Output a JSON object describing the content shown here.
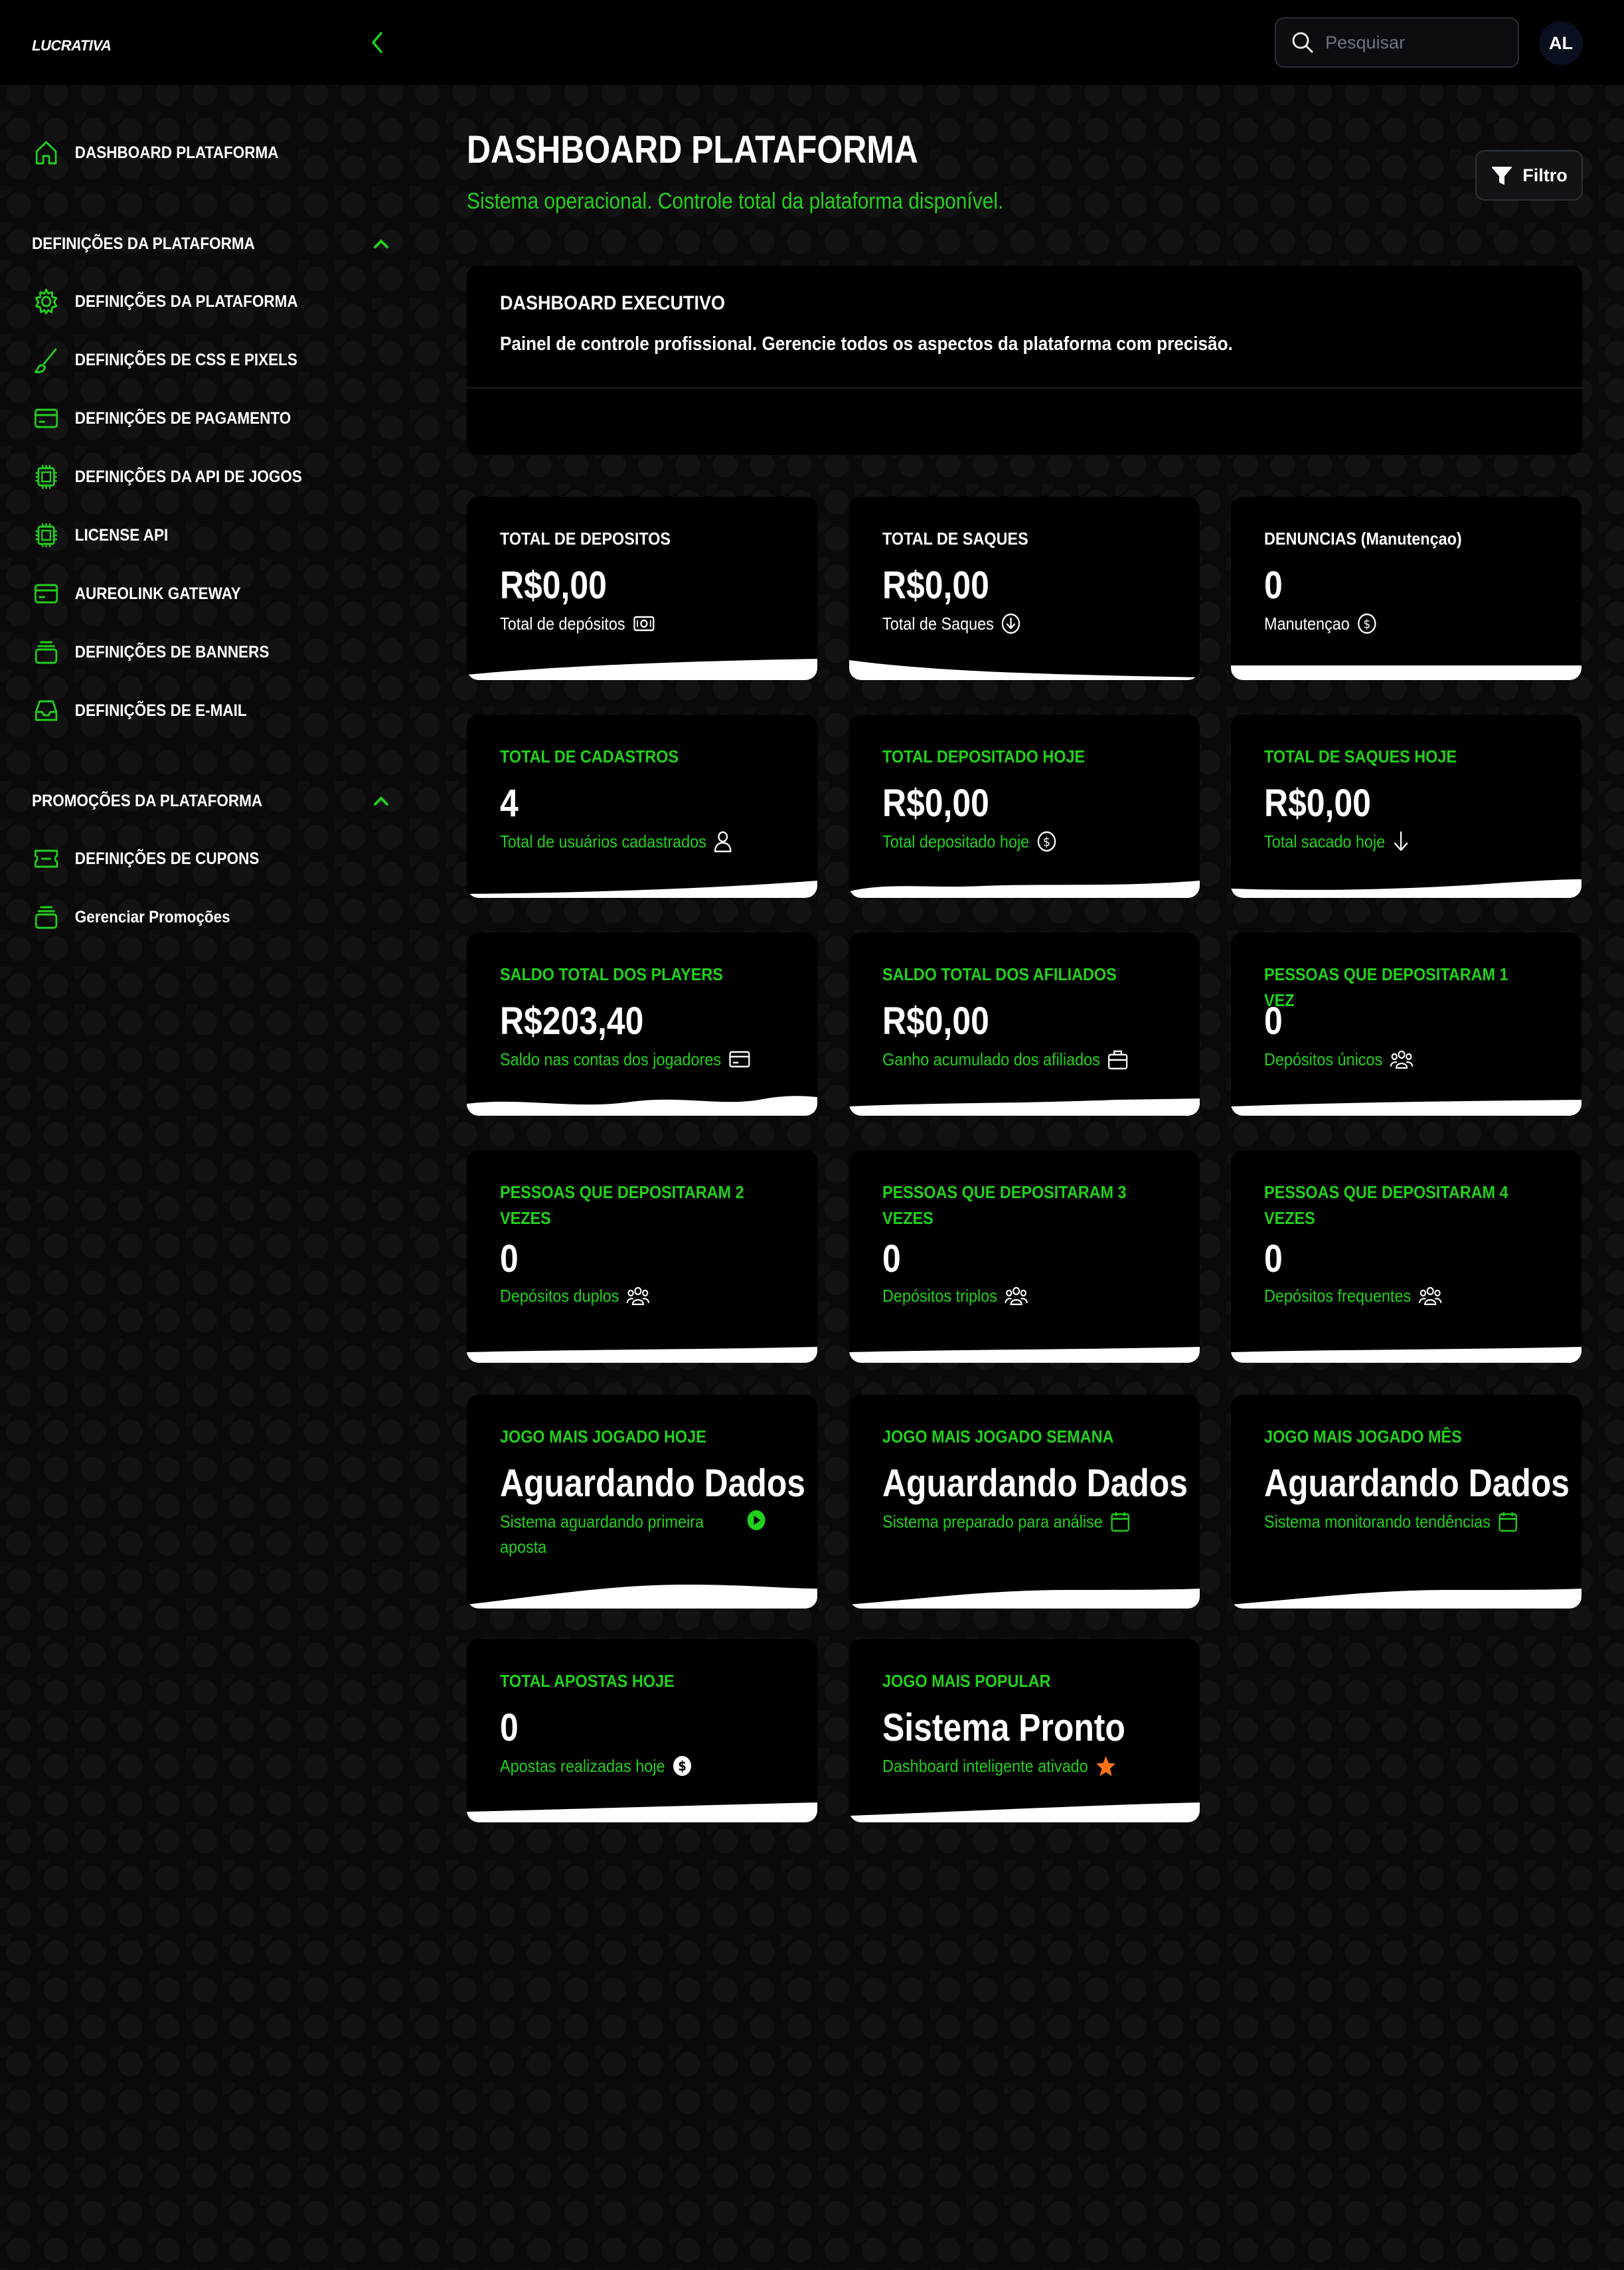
{
  "app": {
    "logo": "LUCRATIVA",
    "avatar": "AL",
    "accent": "#22d11c"
  },
  "search": {
    "placeholder": "Pesquisar",
    "value": ""
  },
  "sidebar": {
    "top_item": {
      "label": "DASHBOARD PLATAFORMA",
      "icon": "home-icon"
    },
    "sections": [
      {
        "title": "DEFINIÇÕES DA PLATAFORMA",
        "expanded": true,
        "items": [
          {
            "label": "DEFINIÇÕES DA PLATAFORMA",
            "icon": "gear-icon"
          },
          {
            "label": "DEFINIÇÕES DE CSS E PIXELS",
            "icon": "brush-icon"
          },
          {
            "label": "DEFINIÇÕES DE PAGAMENTO",
            "icon": "card-icon"
          },
          {
            "label": "DEFINIÇÕES DA API DE JOGOS",
            "icon": "chip-icon"
          },
          {
            "label": "LICENSE API",
            "icon": "chip-icon"
          },
          {
            "label": "AUREOLINK GATEWAY",
            "icon": "card-icon"
          },
          {
            "label": "DEFINIÇÕES DE BANNERS",
            "icon": "stack-icon"
          },
          {
            "label": "DEFINIÇÕES DE E-MAIL",
            "icon": "inbox-icon"
          }
        ]
      },
      {
        "title": "PROMOÇÕES DA PLATAFORMA",
        "expanded": true,
        "items": [
          {
            "label": "DEFINIÇÕES DE CUPONS",
            "icon": "ticket-icon"
          },
          {
            "label": "Gerenciar Promoções",
            "icon": "stack-icon"
          }
        ]
      }
    ]
  },
  "header": {
    "title": "DASHBOARD PLATAFORMA",
    "subtitle": "Sistema operacional. Controle total da plataforma disponível.",
    "filter_label": "Filtro"
  },
  "exec": {
    "title": "DASHBOARD EXECUTIVO",
    "description": "Painel de controle profissional. Gerencie todos os aspectos da plataforma com precisão."
  },
  "cards": [
    {
      "label": "TOTAL DE DEPOSITOS",
      "value": "R$0,00",
      "sub": "Total de depósitos",
      "icon": "cash-icon",
      "style": "white"
    },
    {
      "label": "TOTAL DE SAQUES",
      "value": "R$0,00",
      "sub": "Total de Saques",
      "icon": "arrow-down-circle-icon",
      "style": "white"
    },
    {
      "label": "DENUNCIAS (Manutençao)",
      "value": "0",
      "sub": "Manutençao",
      "icon": "dollar-circle-icon",
      "style": "white"
    },
    {
      "label": "TOTAL DE CADASTROS",
      "value": "4",
      "sub": "Total de usuários cadastrados",
      "icon": "user-icon",
      "style": "green"
    },
    {
      "label": "TOTAL DEPOSITADO HOJE",
      "value": "R$0,00",
      "sub": "Total depositado hoje",
      "icon": "dollar-circle-icon",
      "style": "green"
    },
    {
      "label": "TOTAL DE SAQUES HOJE",
      "value": "R$0,00",
      "sub": "Total sacado hoje",
      "icon": "arrow-down-icon",
      "style": "green"
    },
    {
      "label": "SALDO TOTAL DOS PLAYERS",
      "value": "R$203,40",
      "sub": "Saldo nas contas dos jogadores",
      "icon": "card-icon",
      "style": "green"
    },
    {
      "label": "SALDO TOTAL DOS AFILIADOS",
      "value": "R$0,00",
      "sub": "Ganho acumulado dos afiliados",
      "icon": "briefcase-icon",
      "style": "green"
    },
    {
      "label": "PESSOAS QUE DEPOSITARAM 1 VEZ",
      "value": "0",
      "sub": "Depósitos únicos",
      "icon": "users-icon",
      "style": "green"
    },
    {
      "label": "PESSOAS QUE DEPOSITARAM 2 VEZES",
      "value": "0",
      "sub": "Depósitos duplos",
      "icon": "users-icon",
      "style": "green"
    },
    {
      "label": "PESSOAS QUE DEPOSITARAM 3 VEZES",
      "value": "0",
      "sub": "Depósitos triplos",
      "icon": "users-icon",
      "style": "green"
    },
    {
      "label": "PESSOAS QUE DEPOSITARAM 4 VEZES",
      "value": "0",
      "sub": "Depósitos frequentes",
      "icon": "users-icon",
      "style": "green"
    },
    {
      "label": "JOGO MAIS JOGADO HOJE",
      "value": "Aguardando Dados",
      "sub": "Sistema aguardando primeira aposta",
      "icon": "play-icon",
      "style": "green"
    },
    {
      "label": "JOGO MAIS JOGADO SEMANA",
      "value": "Aguardando Dados",
      "sub": "Sistema preparado para análise",
      "icon": "calendar-icon",
      "style": "green"
    },
    {
      "label": "JOGO MAIS JOGADO MÊS",
      "value": "Aguardando Dados",
      "sub": "Sistema monitorando tendências",
      "icon": "calendar-icon",
      "style": "green"
    },
    {
      "label": "TOTAL APOSTAS HOJE",
      "value": "0",
      "sub": "Apostas realizadas hoje",
      "icon": "coin-icon",
      "style": "green"
    },
    {
      "label": "JOGO MAIS POPULAR",
      "value": "Sistema Pronto",
      "sub": "Dashboard inteligente ativado",
      "icon": "star-icon",
      "style": "green"
    }
  ]
}
